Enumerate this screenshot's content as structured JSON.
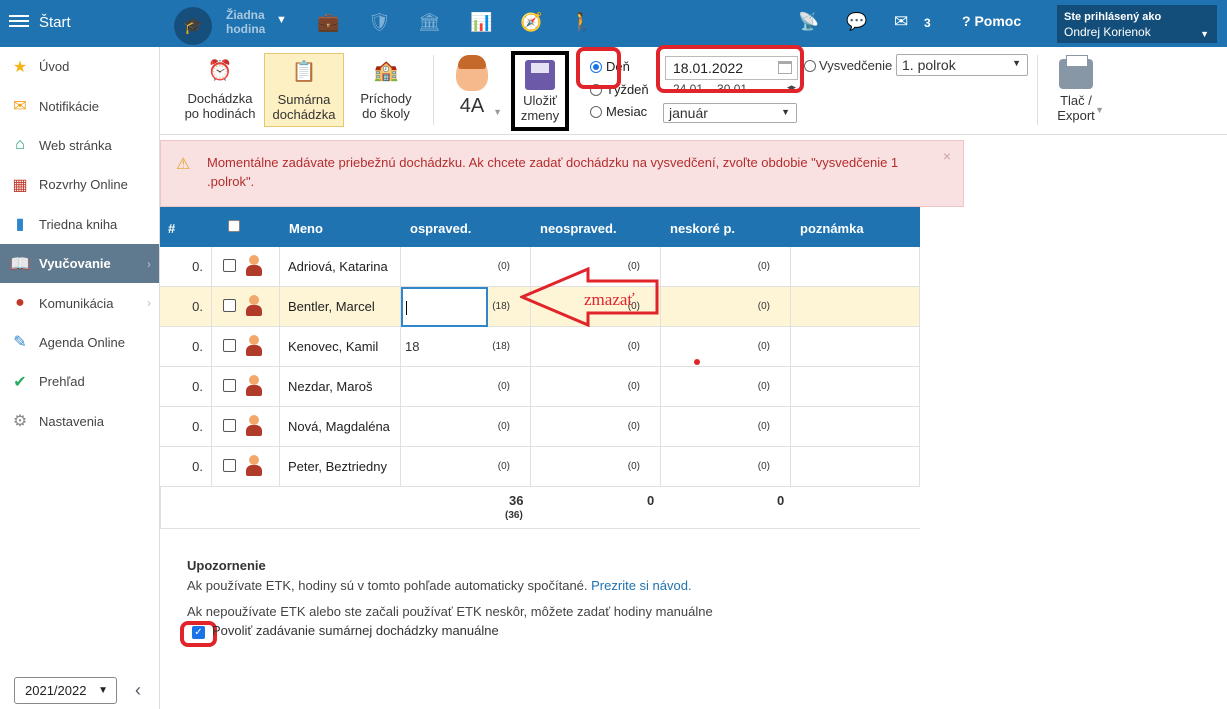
{
  "topbar": {
    "start": "Štart",
    "lesson_line1": "Žiadna",
    "lesson_line2": "hodina",
    "messages_count": "3",
    "help": "Pomoc",
    "user_label": "Ste prihlásený ako",
    "user_name": "Ondrej Korienok"
  },
  "sidebar": {
    "items": [
      {
        "label": "Úvod",
        "icon": "star-icon",
        "color": "#f3b515"
      },
      {
        "label": "Notifikácie",
        "icon": "envelope-icon",
        "color": "#f39c12"
      },
      {
        "label": "Web stránka",
        "icon": "home-icon",
        "color": "#1a9a6c"
      },
      {
        "label": "Rozvrhy Online",
        "icon": "grid-icon",
        "color": "#c0392b"
      },
      {
        "label": "Triedna kniha",
        "icon": "book-icon",
        "color": "#2f87cb"
      },
      {
        "label": "Vyučovanie",
        "icon": "open-book-icon",
        "color": "#ffffff"
      },
      {
        "label": "Komunikácia",
        "icon": "chat-icon",
        "color": "#c0392b"
      },
      {
        "label": "Agenda Online",
        "icon": "pen-icon",
        "color": "#2f87cb"
      },
      {
        "label": "Prehľad",
        "icon": "check-circle-icon",
        "color": "#27ae60"
      },
      {
        "label": "Nastavenia",
        "icon": "gear-icon",
        "color": "#888888"
      }
    ],
    "year": "2021/2022"
  },
  "toolbar": {
    "btn_hours": [
      "Dochádzka",
      "po hodinách"
    ],
    "btn_summary": [
      "Sumárna",
      "dochádzka"
    ],
    "btn_arrivals": [
      "Príchody",
      "do školy"
    ],
    "class_label": "4A",
    "save": [
      "Uložiť",
      "zmeny"
    ],
    "radio_day": "Deň",
    "radio_week": "Týždeň",
    "radio_month": "Mesiac",
    "date_value": "18.01.2022",
    "week_value": "24.01. - 30.01.",
    "month_value": "január",
    "radio_cert": "Vysvedčenie",
    "cert_value": "1. polrok",
    "print": [
      "Tlač /",
      "Export"
    ]
  },
  "alert": {
    "text": "Momentálne zadávate priebežnú dochádzku. Ak chcete zadať dochádzku na vysvedčení, zvoľte obdobie \"vysvedčenie 1 .polrok\"."
  },
  "table": {
    "headers": {
      "num": "#",
      "name": "Meno",
      "excused": "ospraved.",
      "unexcused": "neospraved.",
      "late": "neskoré p.",
      "note": "poznámka"
    },
    "rows": [
      {
        "num": "0.",
        "name": "Adriová, Katarina",
        "excused_val": "",
        "excused_cnt": "(0)",
        "unexcused_cnt": "(0)",
        "late_cnt": "(0)"
      },
      {
        "num": "0.",
        "name": "Bentler, Marcel",
        "excused_val": "",
        "excused_cnt": "(18)",
        "unexcused_cnt": "(0)",
        "late_cnt": "(0)"
      },
      {
        "num": "0.",
        "name": "Kenovec, Kamil",
        "excused_val": "18",
        "excused_cnt": "(18)",
        "unexcused_cnt": "(0)",
        "late_cnt": "(0)"
      },
      {
        "num": "0.",
        "name": "Nezdar, Maroš",
        "excused_val": "",
        "excused_cnt": "(0)",
        "unexcused_cnt": "(0)",
        "late_cnt": "(0)"
      },
      {
        "num": "0.",
        "name": "Nová, Magdaléna",
        "excused_val": "",
        "excused_cnt": "(0)",
        "unexcused_cnt": "(0)",
        "late_cnt": "(0)"
      },
      {
        "num": "0.",
        "name": "Peter, Beztriedny",
        "excused_val": "",
        "excused_cnt": "(0)",
        "unexcused_cnt": "(0)",
        "late_cnt": "(0)"
      }
    ],
    "totals": {
      "excused": "36",
      "excused_sub": "(36)",
      "unexcused": "0",
      "late": "0"
    }
  },
  "annotation": {
    "delete_label": "zmazať"
  },
  "notice": {
    "title": "Upozornenie",
    "line1": "Ak používate ETK, hodiny sú v tomto pohľade automaticky spočítané.",
    "link": "Prezrite si návod.",
    "line2": "Ak nepoužívate ETK alebo ste začali používať ETK neskôr, môžete zadať hodiny manuálne",
    "checkbox_label": "Povoliť zadávanie sumárnej dochádzky manuálne"
  }
}
